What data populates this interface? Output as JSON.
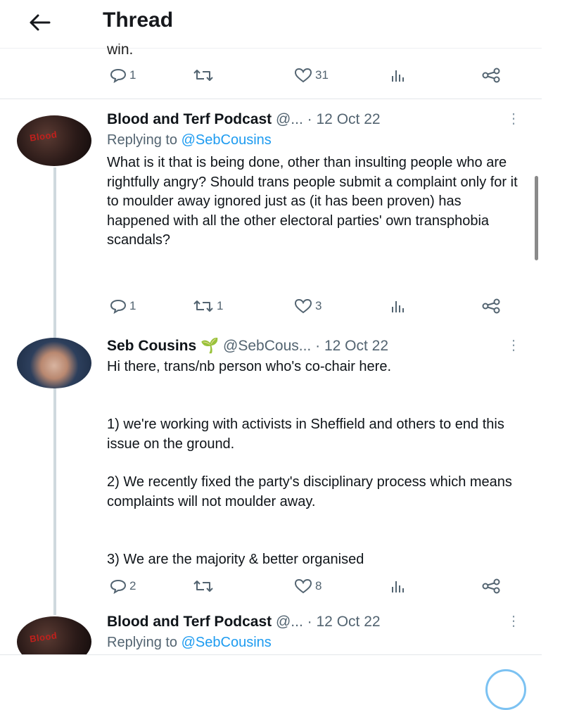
{
  "header": {
    "title": "Thread"
  },
  "top_partial": {
    "cut_text": "win.",
    "stats": {
      "replies": "1",
      "retweets": "",
      "likes": "31"
    }
  },
  "tweets": [
    {
      "name": "Blood and Terf Podcast",
      "handle": "@...",
      "sep": "·",
      "date": "12 Oct 22",
      "replying_prefix": "Replying to",
      "replying_to": "@SebCousins",
      "text": "What is it that is being done, other than insulting people who are rightfully angry? Should trans people submit a complaint only for it to moulder away ignored just as (it has been proven) has happened with all the other electoral parties' own transphobia scandals?",
      "stats": {
        "replies": "1",
        "retweets": "1",
        "likes": "3"
      },
      "avatar_text": "Blood"
    },
    {
      "name": "Seb Cousins",
      "badge": "🌱",
      "handle": "@SebCous...",
      "sep": "·",
      "date": "12 Oct 22",
      "text_lines": [
        "Hi there, trans/nb person who's co-chair here.",
        "1) we're working with activists in Sheffield and others to end this issue on the ground.",
        "2) We recently fixed the party's disciplinary process which means complaints will not moulder away.",
        "3) We are the majority & better organised"
      ],
      "stats": {
        "replies": "2",
        "retweets": "",
        "likes": "8"
      }
    },
    {
      "name": "Blood and Terf Podcast",
      "handle": "@...",
      "sep": "·",
      "date": "12 Oct 22",
      "replying_prefix": "Replying to",
      "replying_to": "@SebCousins",
      "avatar_text": "Blood"
    }
  ],
  "icons": {
    "back": "arrow-left-icon",
    "reply": "reply-icon",
    "retweet": "retweet-icon",
    "like": "heart-icon",
    "views": "views-icon",
    "share": "share-icon",
    "more": "more-icon"
  },
  "colors": {
    "link": "#1d9bf0",
    "muted": "#536471",
    "thread_line": "#cfd9de",
    "sprout": "#2aa84a"
  }
}
